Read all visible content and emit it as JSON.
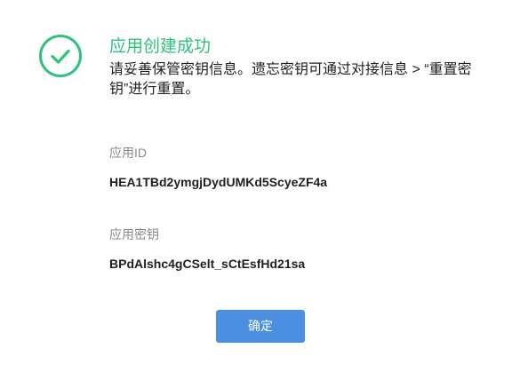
{
  "dialog": {
    "title": "应用创建成功",
    "description": "请妥善保管密钥信息。遗忘密钥可通过对接信息 > “重置密钥”进行重置。",
    "accent_color": "#2ec27e",
    "icon": "check-circle-icon"
  },
  "fields": {
    "app_id": {
      "label": "应用ID",
      "value": "HEA1TBd2ymgjDydUMKd5ScyeZF4a"
    },
    "app_secret": {
      "label": "应用密钥",
      "value": "BPdAlshc4gCSelt_sCtEsfHd21sa"
    }
  },
  "actions": {
    "confirm_label": "确定",
    "confirm_color": "#4a8fe2"
  }
}
